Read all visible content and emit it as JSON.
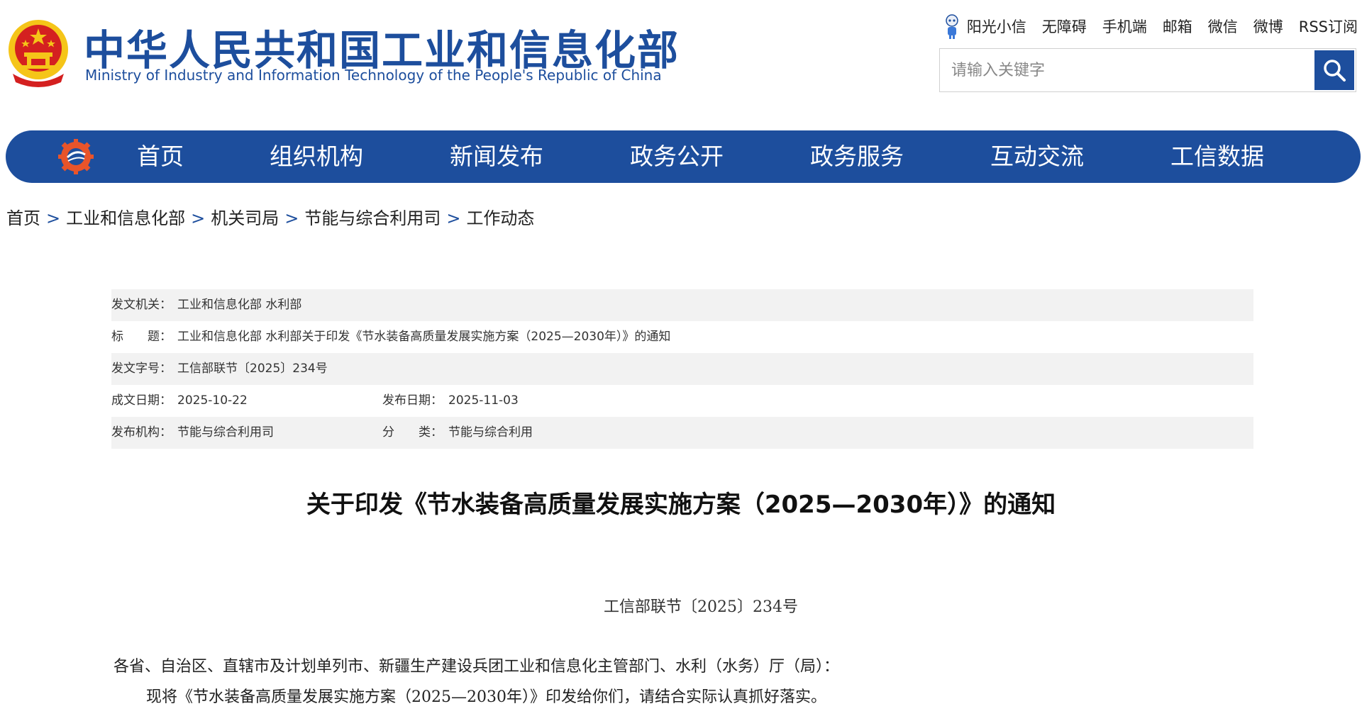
{
  "header": {
    "site_title": "中华人民共和国工业和信息化部",
    "site_subtitle": "Ministry of Industry and Information Technology of the People's Republic of China",
    "top_links": [
      "阳光小信",
      "无障碍",
      "手机端",
      "邮箱",
      "微信",
      "微博",
      "RSS订阅"
    ],
    "search": {
      "placeholder": "请输入关键字"
    }
  },
  "nav": {
    "items": [
      "首页",
      "组织机构",
      "新闻发布",
      "政务公开",
      "政务服务",
      "互动交流",
      "工信数据"
    ]
  },
  "breadcrumb": {
    "items": [
      "首页",
      "工业和信息化部",
      "机关司局",
      "节能与综合利用司",
      "工作动态"
    ],
    "separator": ">"
  },
  "meta": {
    "issuer_label": "发文机关：",
    "issuer": "工业和信息化部 水利部",
    "title_label": "标　　题：",
    "title": "工业和信息化部 水利部关于印发《节水装备高质量发展实施方案（2025—2030年）》的通知",
    "doc_no_label": "发文字号：",
    "doc_no": "工信部联节〔2025〕234号",
    "written_date_label": "成文日期：",
    "written_date": "2025-10-22",
    "publish_date_label": "发布日期：",
    "publish_date": "2025-11-03",
    "publisher_label": "发布机构：",
    "publisher": "节能与综合利用司",
    "category_label": "分　　类：",
    "category": "节能与综合利用"
  },
  "article": {
    "title": "关于印发《节水装备高质量发展实施方案（2025—2030年）》的通知",
    "doc_number": "工信部联节〔2025〕234号",
    "paragraphs": [
      "各省、自治区、直辖市及计划单列市、新疆生产建设兵团工业和信息化主管部门、水利（水务）厅（局）：",
      "现将《节水装备高质量发展实施方案（2025—2030年）》印发给你们，请结合实际认真抓好落实。"
    ]
  },
  "colors": {
    "brand_blue": "#1d4e9d",
    "meta_shade": "#f2f2f2",
    "emblem_red": "#d42020",
    "emblem_gold": "#f5c518"
  }
}
